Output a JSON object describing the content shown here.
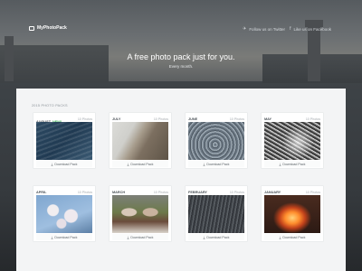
{
  "header": {
    "brand": "MyPhotoPack",
    "twitter": "Follow us on Twitter",
    "facebook": "Like us on Facebook"
  },
  "hero": {
    "title": "A free photo pack just for you.",
    "subtitle": "Every month."
  },
  "section_label": "2015 PHOTO PACKS",
  "download_label": "Download Pack",
  "packs": [
    {
      "month": "AUGUST",
      "badge": "NEW!",
      "count": "10 Photos"
    },
    {
      "month": "JULY",
      "count": "10 Photos"
    },
    {
      "month": "JUNE",
      "count": "10 Photos"
    },
    {
      "month": "MAY",
      "count": "10 Photos"
    },
    {
      "month": "APRIL",
      "count": "10 Photos"
    },
    {
      "month": "MARCH",
      "count": "10 Photos"
    },
    {
      "month": "FEBRUARY",
      "count": "10 Photos"
    },
    {
      "month": "JANUARY",
      "count": "10 Photos"
    }
  ],
  "icons": {
    "brand": "camera-icon",
    "twitter": "twitter-icon",
    "facebook": "facebook-icon",
    "download": "download-icon"
  },
  "colors": {
    "new_badge": "#3fae5a",
    "panel_bg": "#f3f4f5",
    "card_bg": "#ffffff"
  }
}
